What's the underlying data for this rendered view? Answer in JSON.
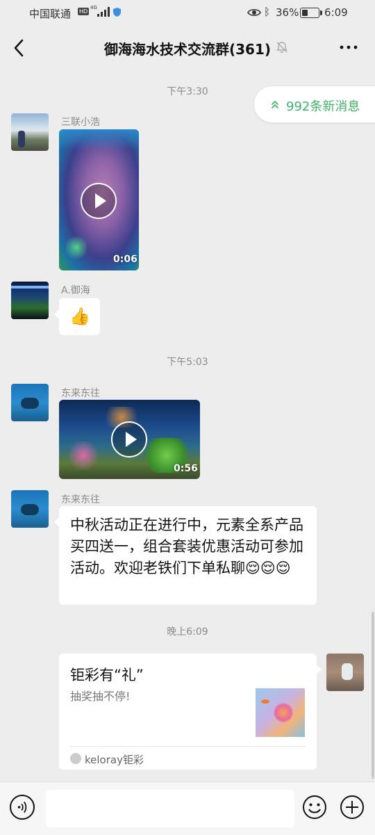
{
  "status_bar": {
    "carrier": "中国联通",
    "hd": "HD",
    "network": "4G",
    "battery": "36%",
    "battery_level": 0.36,
    "time": "6:09"
  },
  "nav": {
    "title": "御海海水技术交流群(361)",
    "muted": true
  },
  "new_messages": {
    "label": "992条新消息"
  },
  "messages": [
    {
      "type": "timestamp",
      "text": "下午3:30"
    },
    {
      "type": "video",
      "sender": "三联小浩",
      "duration": "0:06"
    },
    {
      "type": "sticker",
      "sender": "A.御海",
      "emoji": "👍"
    },
    {
      "type": "timestamp",
      "text": "下午5:03"
    },
    {
      "type": "video",
      "sender": "东来东往",
      "duration": "0:56"
    },
    {
      "type": "text",
      "sender": "东来东往",
      "text": "中秋活动正在进行中，元素全系产品买四送一，组合套装优惠活动可参加活动。欢迎老铁们下单私聊",
      "emojis": "😌😌😌"
    },
    {
      "type": "timestamp",
      "text": "晚上6:09"
    },
    {
      "type": "card",
      "sender": "self",
      "title": "钜彩有“礼”",
      "description": "抽奖抽不停!",
      "source": "keloray钜彩"
    }
  ],
  "input": {
    "placeholder": ""
  },
  "colors": {
    "accent_green": "#3fb36b",
    "background": "#ededed",
    "bubble": "#ffffff"
  }
}
